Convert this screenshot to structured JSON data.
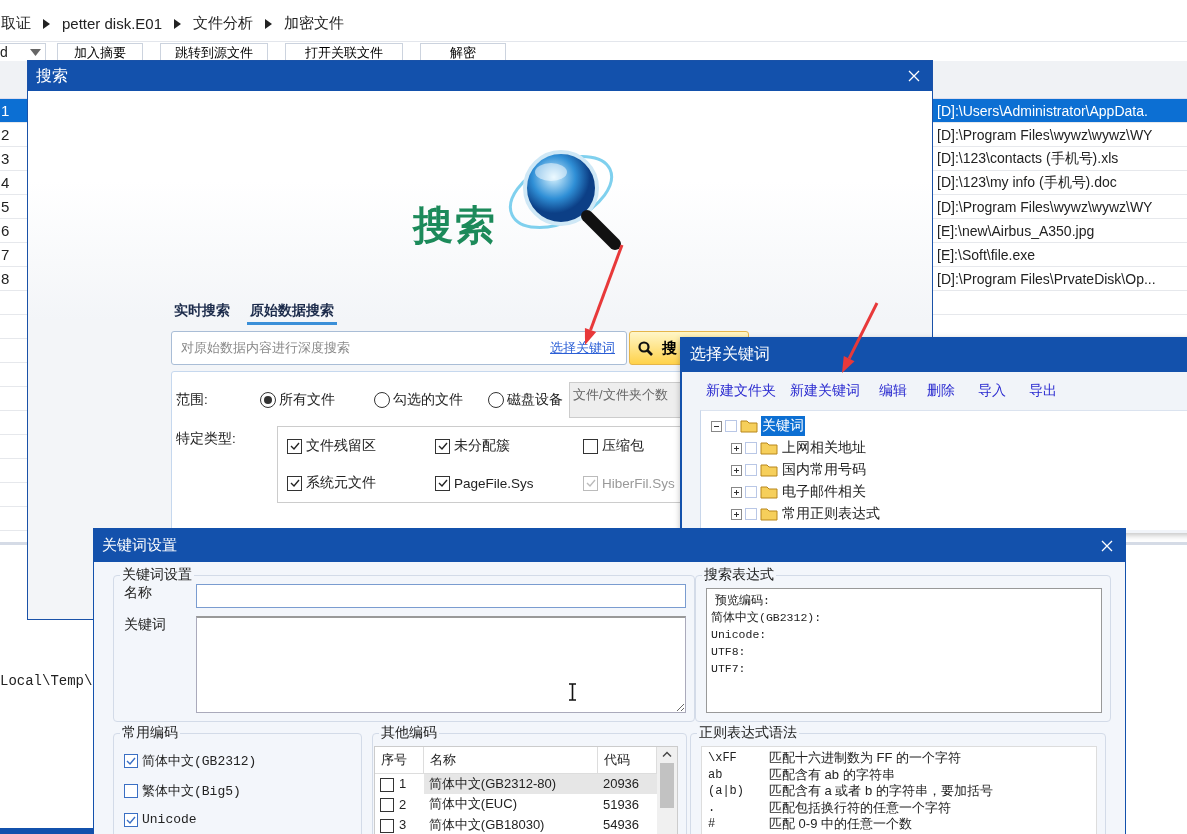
{
  "background": {
    "breadcrumb": [
      "取证",
      "petter disk.E01",
      "文件分析",
      "加密文件"
    ],
    "filter_value": "d",
    "toolbar": [
      "加入摘要",
      "跳转到源文件",
      "打开关联文件",
      "解密"
    ],
    "rows": [
      {
        "index": "1",
        "path": "[D]:\\Users\\Administrator\\AppData.",
        "selected": true
      },
      {
        "index": "2",
        "path": "[D]:\\Program Files\\wywz\\wywz\\WY",
        "selected": false
      },
      {
        "index": "3",
        "path": "[D]:\\123\\contacts (手机号).xls",
        "selected": false
      },
      {
        "index": "4",
        "path": "[D]:\\123\\my info (手机号).doc",
        "selected": false
      },
      {
        "index": "5",
        "path": "[D]:\\Program Files\\wywz\\wywz\\WY",
        "selected": false
      },
      {
        "index": "6",
        "path": "[E]:\\new\\Airbus_A350.jpg",
        "selected": false
      },
      {
        "index": "7",
        "path": "[E]:\\Soft\\file.exe",
        "selected": false
      },
      {
        "index": "8",
        "path": "[D]:\\Program Files\\PrvateDisk\\Op...",
        "selected": false
      }
    ],
    "detail_text": "Local\\Temp\\"
  },
  "search_dialog": {
    "title": "搜索",
    "logo_text": "搜索",
    "tabs": [
      {
        "label": "实时搜索",
        "selected": false
      },
      {
        "label": "原始数据搜索",
        "selected": true
      }
    ],
    "search": {
      "placeholder": "对原始数据内容进行深度搜索",
      "link": "选择关键词",
      "button": "搜"
    },
    "scope": {
      "label": "范围:",
      "options": [
        {
          "label": "所有文件",
          "selected": true
        },
        {
          "label": "勾选的文件",
          "selected": false
        },
        {
          "label": "磁盘设备",
          "selected": false
        }
      ],
      "count_field": "文件/文件夹个数"
    },
    "types": {
      "label": "特定类型:",
      "items": [
        {
          "label": "文件残留区",
          "checked": true,
          "disabled": false
        },
        {
          "label": "未分配簇",
          "checked": true,
          "disabled": false
        },
        {
          "label": "压缩包",
          "checked": false,
          "disabled": false
        },
        {
          "label": "系统元文件",
          "checked": true,
          "disabled": false
        },
        {
          "label": "PageFile.Sys",
          "checked": true,
          "disabled": false
        },
        {
          "label": "HiberFil.Sys",
          "checked": true,
          "disabled": true
        }
      ]
    }
  },
  "keyword_picker": {
    "title": "选择关键词",
    "actions": [
      "新建文件夹",
      "新建关键词",
      "编辑",
      "删除",
      "导入",
      "导出"
    ],
    "tree": [
      {
        "label": "关键词",
        "expanded": true,
        "selected": true,
        "checked": false,
        "children": [
          {
            "label": "上网相关地址",
            "expanded": false,
            "selected": false,
            "checked": false
          },
          {
            "label": "国内常用号码",
            "expanded": false,
            "selected": false,
            "checked": false
          },
          {
            "label": "电子邮件相关",
            "expanded": false,
            "selected": false,
            "checked": false
          },
          {
            "label": "常用正则表达式",
            "expanded": false,
            "selected": false,
            "checked": false
          }
        ]
      }
    ]
  },
  "keyword_settings": {
    "title": "关键词设置",
    "settings_group": {
      "title": "关键词设置",
      "name_label": "名称",
      "keyword_label": "关键词"
    },
    "expression_group": {
      "title": "搜索表达式",
      "lines": [
        "预览编码:",
        "简体中文(GB2312):",
        "Unicode:",
        "UTF8:",
        "UTF7:"
      ]
    },
    "common_encodings": {
      "title": "常用编码",
      "items": [
        {
          "label": "简体中文(GB2312)",
          "checked": true
        },
        {
          "label": "繁体中文(Big5)",
          "checked": false
        },
        {
          "label": "Unicode",
          "checked": true
        }
      ]
    },
    "other_encodings": {
      "title": "其他编码",
      "columns": [
        "序号",
        "名称",
        "代码"
      ],
      "rows": [
        {
          "index": "1",
          "name": "简体中文(GB2312-80)",
          "code": "20936",
          "checked": false,
          "selected": true
        },
        {
          "index": "2",
          "name": "简体中文(EUC)",
          "code": "51936",
          "checked": false,
          "selected": false
        },
        {
          "index": "3",
          "name": "简体中文(GB18030)",
          "code": "54936",
          "checked": false,
          "selected": false
        }
      ]
    },
    "regex_group": {
      "title": "正则表达式语法",
      "rows": [
        {
          "pattern": "\\xFF",
          "description": "匹配十六进制数为 FF 的一个字符"
        },
        {
          "pattern": "ab",
          "description": "匹配含有 ab 的字符串"
        },
        {
          "pattern": "(a|b)",
          "description": "匹配含有 a 或者 b 的字符串，要加括号"
        },
        {
          "pattern": ".",
          "description": "匹配包括换行符的任意一个字符"
        },
        {
          "pattern": "#",
          "description": "匹配 0-9 中的任意一个数"
        }
      ]
    }
  }
}
